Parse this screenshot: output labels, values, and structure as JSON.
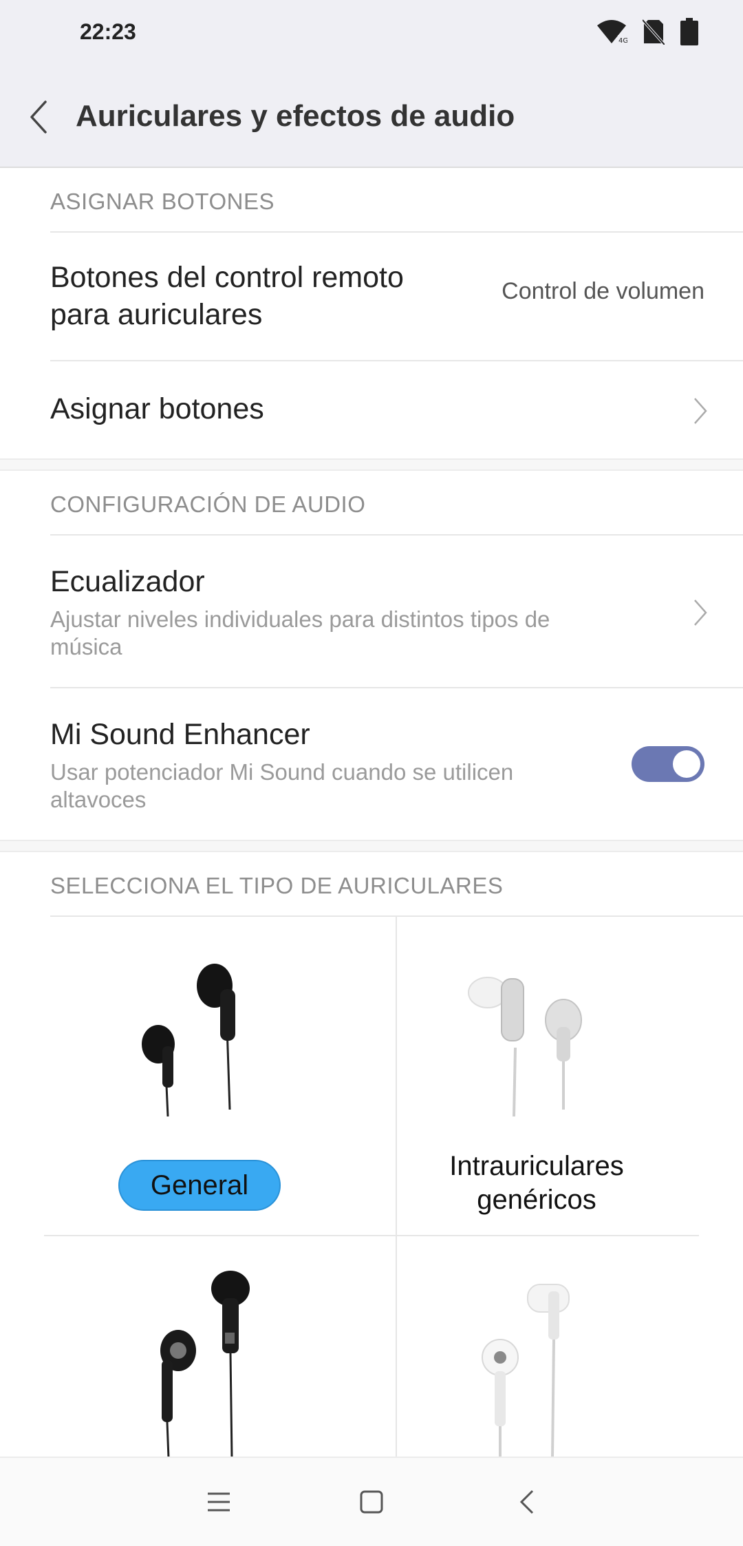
{
  "status_bar": {
    "time": "22:23",
    "icons": [
      "wifi-icon",
      "no-sim-icon",
      "battery-icon"
    ]
  },
  "header": {
    "title": "Auriculares y efectos de audio",
    "back_icon": "chevron-left-icon"
  },
  "sections": {
    "assign": {
      "label": "ASIGNAR BOTONES",
      "remote_title_line1": "Botones del control remoto",
      "remote_title_line2": "para auriculares",
      "remote_value": "Control de volumen",
      "assign_title": "Asignar botones"
    },
    "audio": {
      "label": "CONFIGURACIÓN DE AUDIO",
      "eq_title": "Ecualizador",
      "eq_sub": "Ajustar niveles individuales para distintos tipos de música",
      "enhancer_title": "Mi Sound Enhancer",
      "enhancer_sub": "Usar potenciador Mi Sound cuando se utilicen altavoces",
      "enhancer_enabled": true
    },
    "headphones": {
      "label": "SELECCIONA EL TIPO DE AURICULARES",
      "items": [
        {
          "label": "General",
          "selected": true
        },
        {
          "label_line1": "Intrauriculares",
          "label_line2": "genéricos",
          "selected": false
        }
      ]
    }
  },
  "colors": {
    "toggle_on": "#6b78b3",
    "selected_pill": "#39a9f2",
    "section_label": "#8d8d8d"
  },
  "nav_bar": {
    "icons": [
      "menu-icon",
      "home-icon",
      "back-icon"
    ]
  }
}
